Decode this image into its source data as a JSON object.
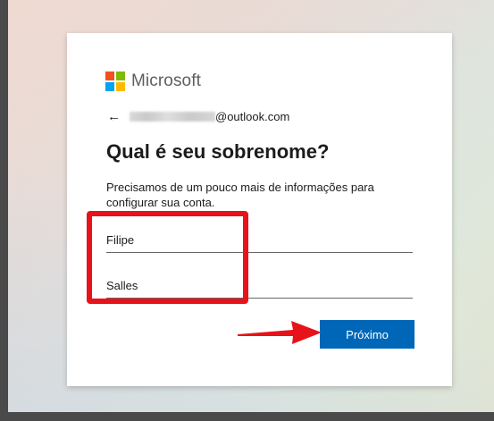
{
  "brand": {
    "name": "Microsoft",
    "colors": [
      "#f25022",
      "#7fba00",
      "#00a4ef",
      "#ffb900"
    ]
  },
  "account": {
    "email_domain": "@outlook.com",
    "back_icon": "back-arrow-icon"
  },
  "page": {
    "title": "Qual é seu sobrenome?",
    "description": "Precisamos de um pouco mais de informações para configurar sua conta."
  },
  "form": {
    "first_name": "Filipe",
    "last_name": "Salles"
  },
  "actions": {
    "next_label": "Próximo",
    "button_color": "#0067b8"
  },
  "annotation": {
    "highlight_color": "#e8121a"
  }
}
